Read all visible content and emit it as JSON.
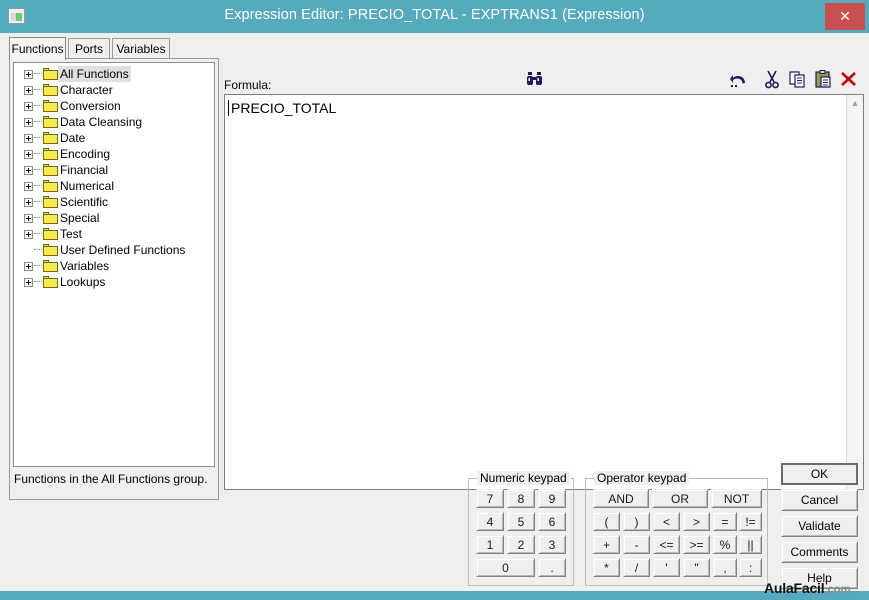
{
  "window": {
    "title": "Expression Editor: PRECIO_TOTAL - EXPTRANS1 (Expression)",
    "app_icon": "window-icon",
    "close_label": "✕",
    "titlebar_color": "#55abbd",
    "close_button_color": "#c75050"
  },
  "tabs": [
    {
      "label": "Functions",
      "selected": true
    },
    {
      "label": "Ports",
      "selected": false
    },
    {
      "label": "Variables",
      "selected": false
    }
  ],
  "tree": {
    "items": [
      {
        "label": "All Functions",
        "expandable": true,
        "selected": true
      },
      {
        "label": "Character",
        "expandable": true,
        "selected": false
      },
      {
        "label": "Conversion",
        "expandable": true,
        "selected": false
      },
      {
        "label": "Data Cleansing",
        "expandable": true,
        "selected": false
      },
      {
        "label": "Date",
        "expandable": true,
        "selected": false
      },
      {
        "label": "Encoding",
        "expandable": true,
        "selected": false
      },
      {
        "label": "Financial",
        "expandable": true,
        "selected": false
      },
      {
        "label": "Numerical",
        "expandable": true,
        "selected": false
      },
      {
        "label": "Scientific",
        "expandable": true,
        "selected": false
      },
      {
        "label": "Special",
        "expandable": true,
        "selected": false
      },
      {
        "label": "Test",
        "expandable": true,
        "selected": false
      },
      {
        "label": "User Defined Functions",
        "expandable": false,
        "selected": false
      },
      {
        "label": "Variables",
        "expandable": true,
        "selected": false
      },
      {
        "label": "Lookups",
        "expandable": true,
        "selected": false
      }
    ],
    "status": "Functions in the All Functions group."
  },
  "formula": {
    "label": "Formula:",
    "value": "PRECIO_TOTAL"
  },
  "toolbar": {
    "find_icon": "binoculars-icon",
    "combo_value": "",
    "combo_placeholder": "",
    "undo_icon": "undo-icon",
    "cut_icon": "scissors-icon",
    "copy_icon": "copy-icon",
    "paste_icon": "paste-icon",
    "delete_icon": "delete-x-icon"
  },
  "numeric_keypad": {
    "title": "Numeric keypad",
    "keys": [
      "7",
      "8",
      "9",
      "4",
      "5",
      "6",
      "1",
      "2",
      "3"
    ],
    "zero": "0",
    "decimal": "."
  },
  "operator_keypad": {
    "title": "Operator keypad",
    "logical": [
      "AND",
      "OR",
      "NOT"
    ],
    "row2": [
      "(",
      ")",
      "<",
      ">",
      "=",
      "!="
    ],
    "row3": [
      "+",
      "-",
      "<=",
      ">=",
      "%",
      "||"
    ],
    "row4": [
      "*",
      "/",
      "'",
      "\"",
      ",",
      ":"
    ]
  },
  "actions": [
    {
      "label": "OK",
      "default": true
    },
    {
      "label": "Cancel",
      "default": false
    },
    {
      "label": "Validate",
      "default": false
    },
    {
      "label": "Comments",
      "default": false
    },
    {
      "label": "Help",
      "default": false
    }
  ],
  "watermark": {
    "name": "AulaFacil",
    "suffix": ".com"
  }
}
